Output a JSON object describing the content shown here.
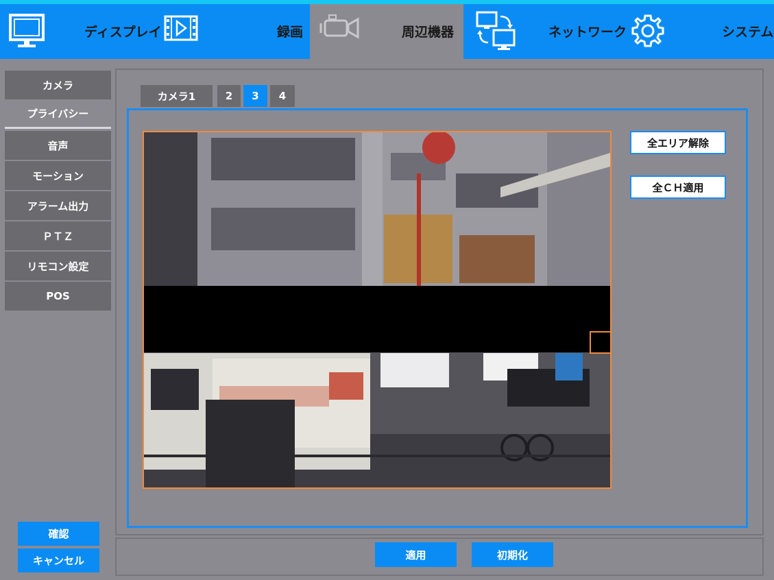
{
  "nav": [
    {
      "label": "ディスプレイ",
      "icon": "monitor-icon"
    },
    {
      "label": "録画",
      "icon": "film-play-icon"
    },
    {
      "label": "周辺機器",
      "icon": "camera-icon",
      "active": true
    },
    {
      "label": "ネットワーク",
      "icon": "network-monitors-icon"
    },
    {
      "label": "システム",
      "icon": "gear-icon"
    }
  ],
  "sidebar": [
    {
      "label": "カメラ"
    },
    {
      "label": "プライバシー",
      "active": true
    },
    {
      "label": "音声"
    },
    {
      "label": "モーション"
    },
    {
      "label": "アラーム出力"
    },
    {
      "label": "ＰＴＺ"
    },
    {
      "label": "リモコン設定"
    },
    {
      "label": "POS"
    }
  ],
  "tabs": [
    {
      "label": "カメラ1"
    },
    {
      "label": "2"
    },
    {
      "label": "3",
      "active": true
    },
    {
      "label": "4"
    }
  ],
  "actions": {
    "clear_all": "全エリア解除",
    "apply_all_ch": "全ＣＨ適用"
  },
  "bottom": {
    "apply": "適用",
    "reset": "初期化"
  },
  "footer": {
    "confirm": "確認",
    "cancel": "キャンセル"
  },
  "colors": {
    "accent": "#0b8cf5",
    "frame": "#1a8cf3",
    "mask_border": "#f08b3c",
    "background": "#8b8a90"
  }
}
